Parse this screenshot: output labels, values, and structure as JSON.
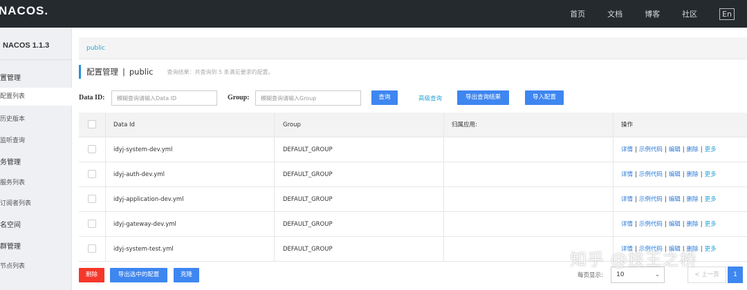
{
  "header": {
    "logo": "NACOS.",
    "nav": [
      "首页",
      "文档",
      "博客",
      "社区"
    ],
    "lang": "En"
  },
  "sidebar": {
    "version": "NACOS 1.1.3",
    "items": [
      {
        "label": "置管理",
        "group": true
      },
      {
        "label": "配置列表",
        "active": true
      },
      {
        "label": "历史版本"
      },
      {
        "label": "监听查询"
      },
      {
        "label": "务管理",
        "group": true
      },
      {
        "label": "服务列表"
      },
      {
        "label": "订阅者列表"
      },
      {
        "label": "名空间",
        "group": true
      },
      {
        "label": "群管理",
        "group": true
      },
      {
        "label": "节点列表"
      }
    ]
  },
  "breadcrumb": "public",
  "title": {
    "main": "配置管理",
    "separator": "|",
    "namespace": "public",
    "summary": "查询结果：共查询到 5 条满足要求的配置。"
  },
  "search": {
    "dataid_label": "Data ID:",
    "dataid_placeholder": "模糊查询请输入Data ID",
    "group_label": "Group:",
    "group_placeholder": "模糊查询请输入Group",
    "query_btn": "查询",
    "advanced": "高级查询",
    "export_btn": "导出查询结果",
    "import_btn": "导入配置"
  },
  "table": {
    "columns": [
      "Data Id",
      "Group",
      "归属应用:",
      "操作"
    ],
    "rows": [
      {
        "dataid": "idyj-system-dev.yml",
        "group": "DEFAULT_GROUP",
        "app": ""
      },
      {
        "dataid": "idyj-auth-dev.yml",
        "group": "DEFAULT_GROUP",
        "app": ""
      },
      {
        "dataid": "idyj-application-dev.yml",
        "group": "DEFAULT_GROUP",
        "app": ""
      },
      {
        "dataid": "idyj-gateway-dev.yml",
        "group": "DEFAULT_GROUP",
        "app": ""
      },
      {
        "dataid": "idyj-system-test.yml",
        "group": "DEFAULT_GROUP",
        "app": ""
      }
    ],
    "ops": {
      "detail": "详情",
      "sample": "示例代码",
      "edit": "编辑",
      "delete": "删除",
      "more": "更多",
      "sep": "|"
    }
  },
  "footer": {
    "delete_btn": "删除",
    "export_selected_btn": "导出选中的配置",
    "clone_btn": "克隆",
    "per_page_label": "每页显示:",
    "per_page_value": "10",
    "prev": "< 上一页",
    "current_page": "1"
  },
  "watermark": "知乎 @技王之桥"
}
